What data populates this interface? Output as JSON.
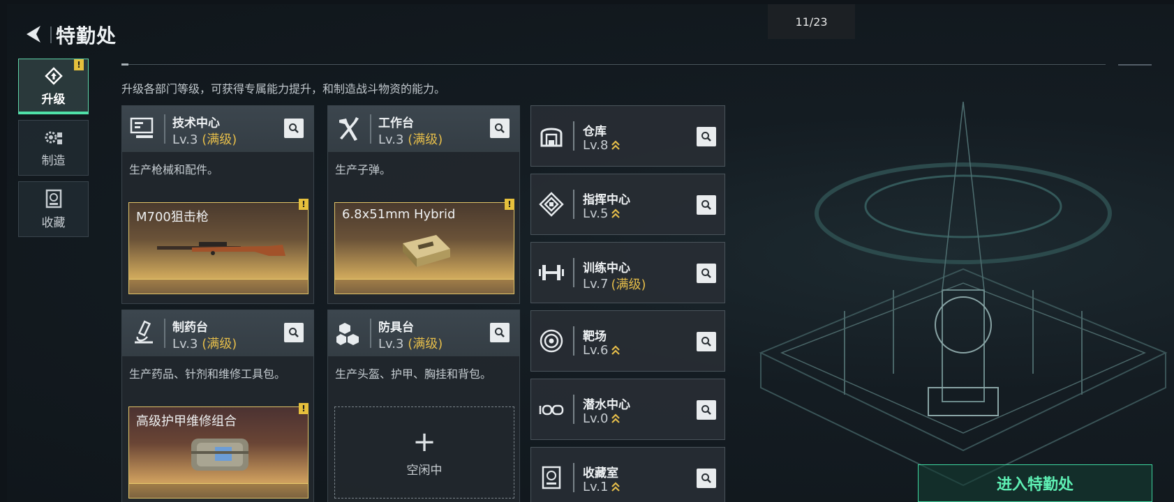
{
  "header": {
    "title": "特勤处",
    "page_counter": "11/23"
  },
  "nav": {
    "items": [
      {
        "label": "升级",
        "active": true,
        "badge": "!"
      },
      {
        "label": "制造",
        "active": false
      },
      {
        "label": "收藏",
        "active": false
      }
    ]
  },
  "description": "升级各部门等级，可获得专属能力提升，和制造战斗物资的能力。",
  "facilities": [
    {
      "name": "技术中心",
      "level": "Lv.3",
      "max": "(满级)",
      "desc": "生产枪械和配件。",
      "craft": {
        "name": "M700狙击枪",
        "badge": "!"
      }
    },
    {
      "name": "工作台",
      "level": "Lv.3",
      "max": "(满级)",
      "desc": "生产子弹。",
      "craft": {
        "name": "6.8x51mm Hybrid",
        "badge": "!"
      }
    },
    {
      "name": "制药台",
      "level": "Lv.3",
      "max": "(满级)",
      "desc": "生产药品、针剂和维修工具包。",
      "craft": {
        "name": "高级护甲维修组合",
        "badge": "!"
      }
    },
    {
      "name": "防具台",
      "level": "Lv.3",
      "max": "(满级)",
      "desc": "生产头盔、护甲、胸挂和背包。",
      "idle": {
        "plus": "+",
        "label": "空闲中"
      }
    }
  ],
  "rooms": [
    {
      "name": "仓库",
      "level": "Lv.8",
      "max": "",
      "icon": "warehouse-icon"
    },
    {
      "name": "指挥中心",
      "level": "Lv.5",
      "max": "",
      "icon": "command-icon"
    },
    {
      "name": "训练中心",
      "level": "Lv.7",
      "max": "(满级)",
      "icon": "dumbbell-icon"
    },
    {
      "name": "靶场",
      "level": "Lv.6",
      "max": "",
      "icon": "target-icon"
    },
    {
      "name": "潜水中心",
      "level": "Lv.0",
      "max": "",
      "icon": "goggles-icon"
    },
    {
      "name": "收藏室",
      "level": "Lv.1",
      "max": "",
      "icon": "collection-icon"
    }
  ],
  "enter_button": "进入特勤处",
  "colors": {
    "accent": "#4fe0a8",
    "max_level": "#e5bd4a",
    "badge": "#e6c03c"
  }
}
